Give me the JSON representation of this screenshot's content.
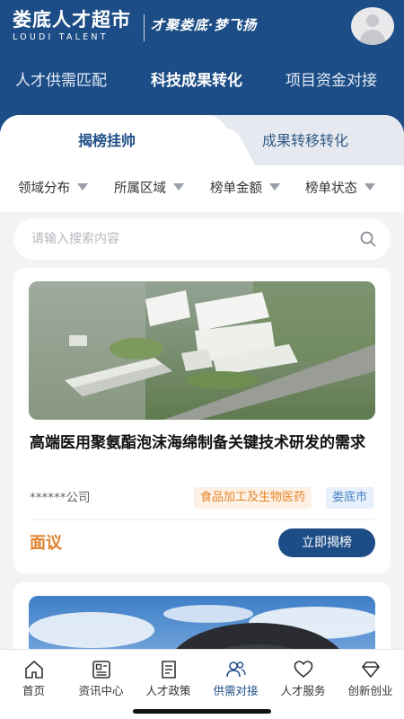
{
  "brand": {
    "name_cn": "娄底人才超市",
    "name_en": "LOUDI TALENT",
    "slogan": "才聚娄底·梦飞扬"
  },
  "top_tabs": [
    {
      "label": "人才供需匹配",
      "active": false
    },
    {
      "label": "科技成果转化",
      "active": true
    },
    {
      "label": "项目资金对接",
      "active": false
    }
  ],
  "sub_tabs": [
    {
      "label": "揭榜挂帅",
      "active": true
    },
    {
      "label": "成果转移转化",
      "active": false
    }
  ],
  "filters": [
    {
      "label": "领域分布"
    },
    {
      "label": "所属区域"
    },
    {
      "label": "榜单金额"
    },
    {
      "label": "榜单状态"
    }
  ],
  "search": {
    "placeholder": "请输入搜索内容"
  },
  "cards": [
    {
      "title": "高端医用聚氨酯泡沫海绵制备关键技术研发的需求",
      "company": "******公司",
      "tags": [
        "食品加工及生物医药",
        "娄底市"
      ],
      "price": "面议",
      "action_label": "立即揭榜"
    }
  ],
  "bottom_nav": [
    {
      "label": "首页",
      "icon": "home-icon",
      "active": false
    },
    {
      "label": "资讯中心",
      "icon": "news-icon",
      "active": false
    },
    {
      "label": "人才政策",
      "icon": "policy-icon",
      "active": false
    },
    {
      "label": "供需对接",
      "icon": "users-icon",
      "active": true
    },
    {
      "label": "人才服务",
      "icon": "heart-icon",
      "active": false
    },
    {
      "label": "创新创业",
      "icon": "diamond-icon",
      "active": false
    }
  ],
  "colors": {
    "primary": "#1d4d86",
    "accent_orange": "#e0822e",
    "tag_blue": "#4a83c4"
  }
}
